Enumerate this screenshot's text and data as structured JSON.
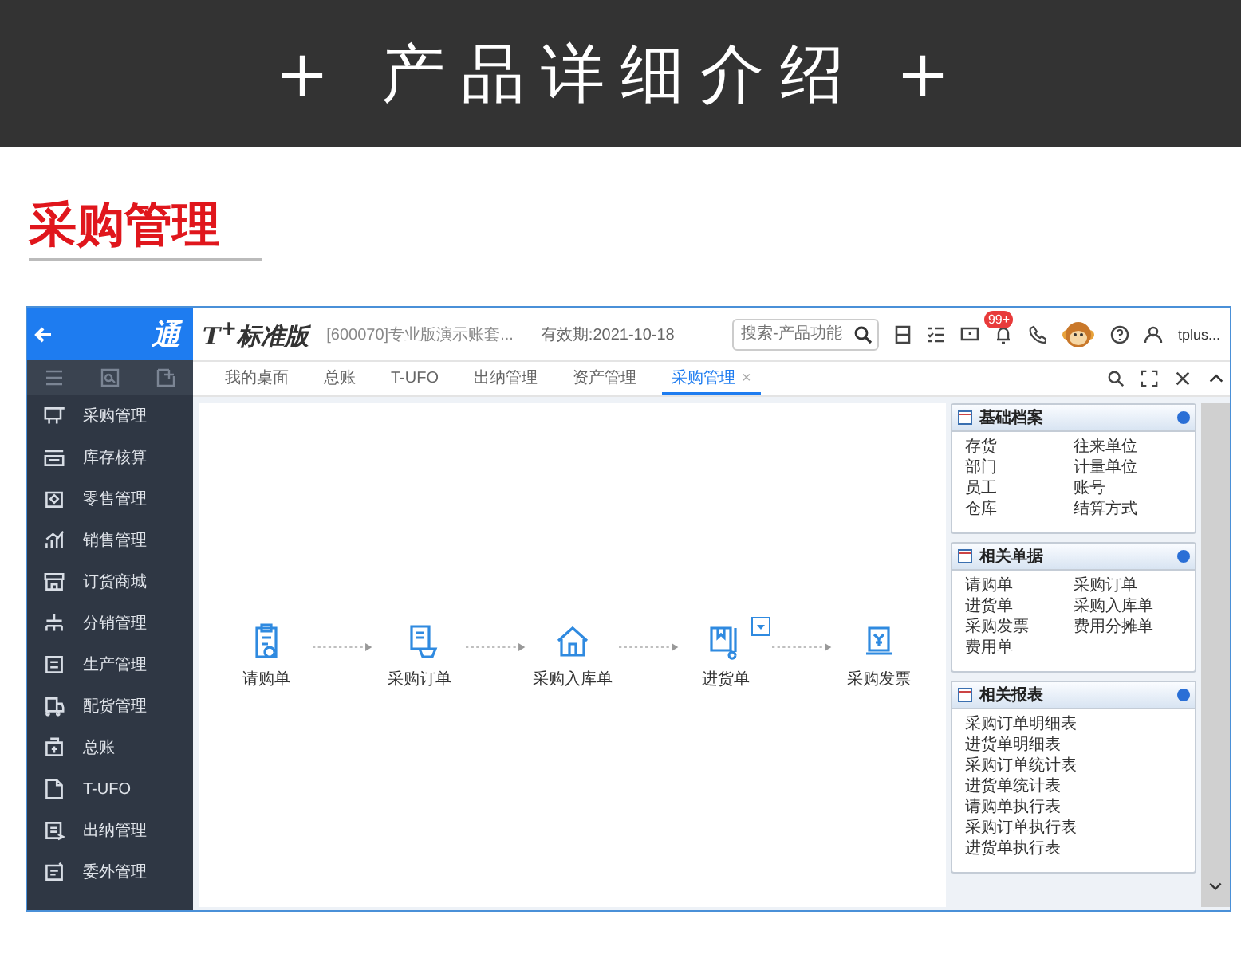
{
  "banner": {
    "title": "+ 产品详细介绍 +"
  },
  "section_title": "采购管理",
  "app": {
    "brand": "通",
    "logo": "T$^{+}$标准版",
    "account": "[600070]专业版演示账套...",
    "validity": "有效期:2021-10-18",
    "search": {
      "placeholder": "搜索-产品功能"
    },
    "badge": "99+",
    "user": "tplus...",
    "sidebar": [
      {
        "label": "采购管理"
      },
      {
        "label": "库存核算"
      },
      {
        "label": "零售管理"
      },
      {
        "label": "销售管理"
      },
      {
        "label": "订货商城"
      },
      {
        "label": "分销管理"
      },
      {
        "label": "生产管理"
      },
      {
        "label": "配货管理"
      },
      {
        "label": "总账"
      },
      {
        "label": "T-UFO"
      },
      {
        "label": "出纳管理"
      },
      {
        "label": "委外管理"
      }
    ],
    "tabs": [
      {
        "label": "我的桌面",
        "selected": false
      },
      {
        "label": "总账",
        "selected": false
      },
      {
        "label": "T-UFO",
        "selected": false
      },
      {
        "label": "出纳管理",
        "selected": false
      },
      {
        "label": "资产管理",
        "selected": false
      },
      {
        "label": "采购管理",
        "selected": true,
        "close": "×"
      }
    ],
    "flow": [
      {
        "label": "请购单",
        "dropdown": false
      },
      {
        "label": "采购订单",
        "dropdown": false
      },
      {
        "label": "采购入库单",
        "dropdown": false
      },
      {
        "label": "进货单",
        "dropdown": true
      },
      {
        "label": "采购发票",
        "dropdown": false
      }
    ],
    "panels": [
      {
        "title": "基础档案",
        "columns": [
          [
            "存货",
            "部门",
            "员工",
            "仓库"
          ],
          [
            "往来单位",
            "计量单位",
            "账号",
            "结算方式"
          ]
        ]
      },
      {
        "title": "相关单据",
        "columns": [
          [
            "请购单",
            "进货单",
            "采购发票",
            "费用单"
          ],
          [
            "采购订单",
            "采购入库单",
            "费用分摊单"
          ]
        ]
      },
      {
        "title": "相关报表",
        "columns": [
          [
            "采购订单明细表",
            "进货单明细表",
            "采购订单统计表",
            "进货单统计表",
            "请购单执行表",
            "采购订单执行表",
            "进货单执行表"
          ]
        ]
      }
    ]
  }
}
